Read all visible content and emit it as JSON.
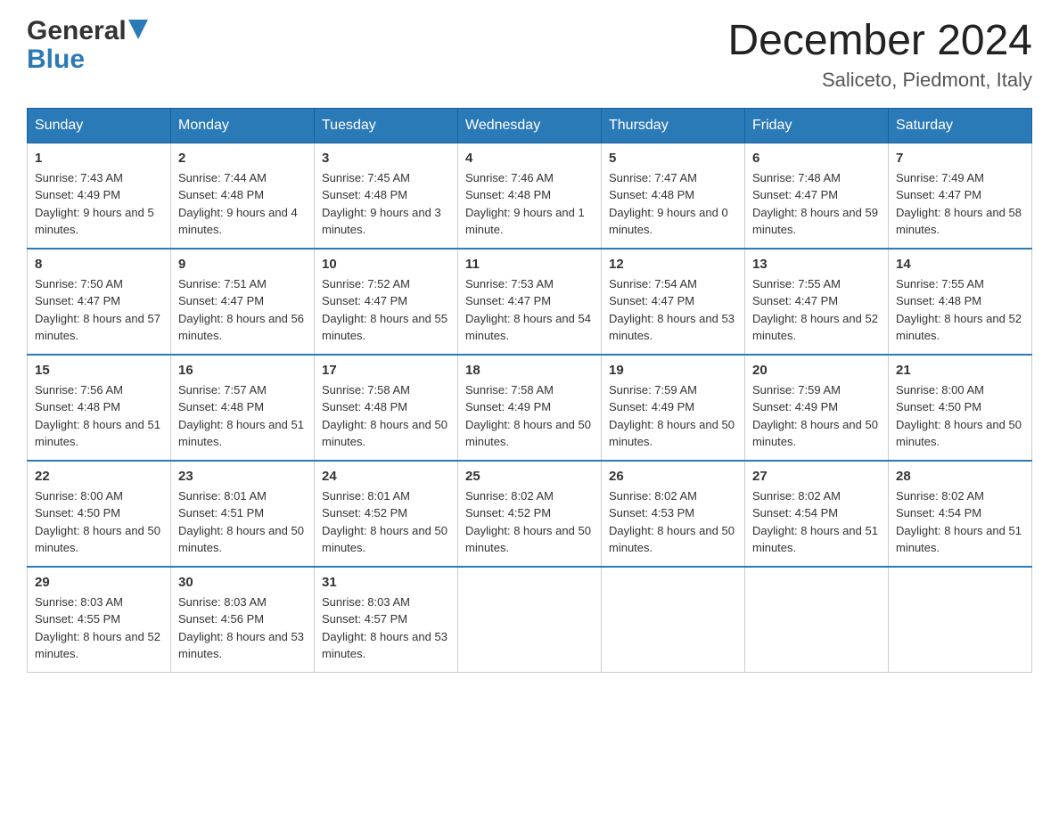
{
  "header": {
    "logo_general": "General",
    "logo_blue": "Blue",
    "title": "December 2024",
    "location": "Saliceto, Piedmont, Italy"
  },
  "days_of_week": [
    "Sunday",
    "Monday",
    "Tuesday",
    "Wednesday",
    "Thursday",
    "Friday",
    "Saturday"
  ],
  "weeks": [
    [
      {
        "day": "1",
        "sunrise": "7:43 AM",
        "sunset": "4:49 PM",
        "daylight": "9 hours and 5 minutes."
      },
      {
        "day": "2",
        "sunrise": "7:44 AM",
        "sunset": "4:48 PM",
        "daylight": "9 hours and 4 minutes."
      },
      {
        "day": "3",
        "sunrise": "7:45 AM",
        "sunset": "4:48 PM",
        "daylight": "9 hours and 3 minutes."
      },
      {
        "day": "4",
        "sunrise": "7:46 AM",
        "sunset": "4:48 PM",
        "daylight": "9 hours and 1 minute."
      },
      {
        "day": "5",
        "sunrise": "7:47 AM",
        "sunset": "4:48 PM",
        "daylight": "9 hours and 0 minutes."
      },
      {
        "day": "6",
        "sunrise": "7:48 AM",
        "sunset": "4:47 PM",
        "daylight": "8 hours and 59 minutes."
      },
      {
        "day": "7",
        "sunrise": "7:49 AM",
        "sunset": "4:47 PM",
        "daylight": "8 hours and 58 minutes."
      }
    ],
    [
      {
        "day": "8",
        "sunrise": "7:50 AM",
        "sunset": "4:47 PM",
        "daylight": "8 hours and 57 minutes."
      },
      {
        "day": "9",
        "sunrise": "7:51 AM",
        "sunset": "4:47 PM",
        "daylight": "8 hours and 56 minutes."
      },
      {
        "day": "10",
        "sunrise": "7:52 AM",
        "sunset": "4:47 PM",
        "daylight": "8 hours and 55 minutes."
      },
      {
        "day": "11",
        "sunrise": "7:53 AM",
        "sunset": "4:47 PM",
        "daylight": "8 hours and 54 minutes."
      },
      {
        "day": "12",
        "sunrise": "7:54 AM",
        "sunset": "4:47 PM",
        "daylight": "8 hours and 53 minutes."
      },
      {
        "day": "13",
        "sunrise": "7:55 AM",
        "sunset": "4:47 PM",
        "daylight": "8 hours and 52 minutes."
      },
      {
        "day": "14",
        "sunrise": "7:55 AM",
        "sunset": "4:48 PM",
        "daylight": "8 hours and 52 minutes."
      }
    ],
    [
      {
        "day": "15",
        "sunrise": "7:56 AM",
        "sunset": "4:48 PM",
        "daylight": "8 hours and 51 minutes."
      },
      {
        "day": "16",
        "sunrise": "7:57 AM",
        "sunset": "4:48 PM",
        "daylight": "8 hours and 51 minutes."
      },
      {
        "day": "17",
        "sunrise": "7:58 AM",
        "sunset": "4:48 PM",
        "daylight": "8 hours and 50 minutes."
      },
      {
        "day": "18",
        "sunrise": "7:58 AM",
        "sunset": "4:49 PM",
        "daylight": "8 hours and 50 minutes."
      },
      {
        "day": "19",
        "sunrise": "7:59 AM",
        "sunset": "4:49 PM",
        "daylight": "8 hours and 50 minutes."
      },
      {
        "day": "20",
        "sunrise": "7:59 AM",
        "sunset": "4:49 PM",
        "daylight": "8 hours and 50 minutes."
      },
      {
        "day": "21",
        "sunrise": "8:00 AM",
        "sunset": "4:50 PM",
        "daylight": "8 hours and 50 minutes."
      }
    ],
    [
      {
        "day": "22",
        "sunrise": "8:00 AM",
        "sunset": "4:50 PM",
        "daylight": "8 hours and 50 minutes."
      },
      {
        "day": "23",
        "sunrise": "8:01 AM",
        "sunset": "4:51 PM",
        "daylight": "8 hours and 50 minutes."
      },
      {
        "day": "24",
        "sunrise": "8:01 AM",
        "sunset": "4:52 PM",
        "daylight": "8 hours and 50 minutes."
      },
      {
        "day": "25",
        "sunrise": "8:02 AM",
        "sunset": "4:52 PM",
        "daylight": "8 hours and 50 minutes."
      },
      {
        "day": "26",
        "sunrise": "8:02 AM",
        "sunset": "4:53 PM",
        "daylight": "8 hours and 50 minutes."
      },
      {
        "day": "27",
        "sunrise": "8:02 AM",
        "sunset": "4:54 PM",
        "daylight": "8 hours and 51 minutes."
      },
      {
        "day": "28",
        "sunrise": "8:02 AM",
        "sunset": "4:54 PM",
        "daylight": "8 hours and 51 minutes."
      }
    ],
    [
      {
        "day": "29",
        "sunrise": "8:03 AM",
        "sunset": "4:55 PM",
        "daylight": "8 hours and 52 minutes."
      },
      {
        "day": "30",
        "sunrise": "8:03 AM",
        "sunset": "4:56 PM",
        "daylight": "8 hours and 53 minutes."
      },
      {
        "day": "31",
        "sunrise": "8:03 AM",
        "sunset": "4:57 PM",
        "daylight": "8 hours and 53 minutes."
      },
      null,
      null,
      null,
      null
    ]
  ]
}
